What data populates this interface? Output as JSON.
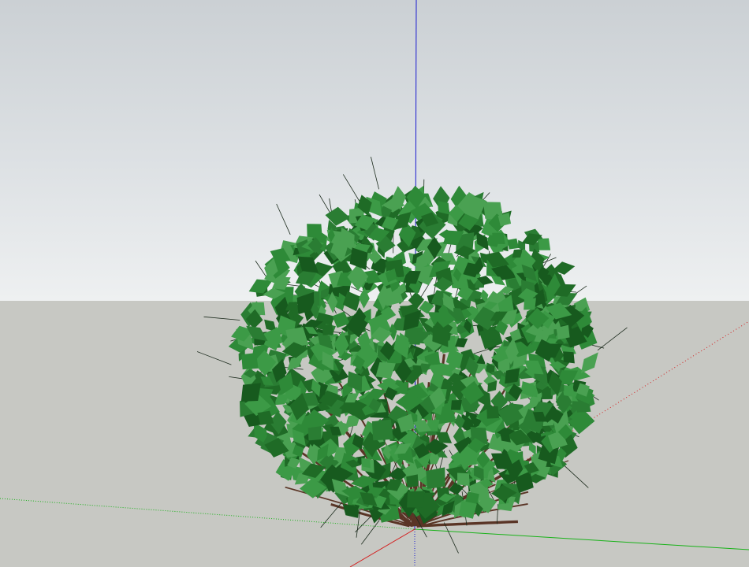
{
  "scene": {
    "sky_top_color": "#cbd0d4",
    "sky_horizon_color": "#eef0f1",
    "ground_color": "#c7c8c3"
  },
  "axes": {
    "red_axis_color": "#d32020",
    "green_axis_color": "#18b218",
    "blue_axis_color": "#1a1ad0"
  },
  "model": {
    "name": "shrub-component",
    "leaf_colors": [
      "#1f6b26",
      "#2e8a38",
      "#3c9a46",
      "#175a1e",
      "#4aa152",
      "#2a7d33"
    ],
    "branch_color": "#5a3526"
  }
}
